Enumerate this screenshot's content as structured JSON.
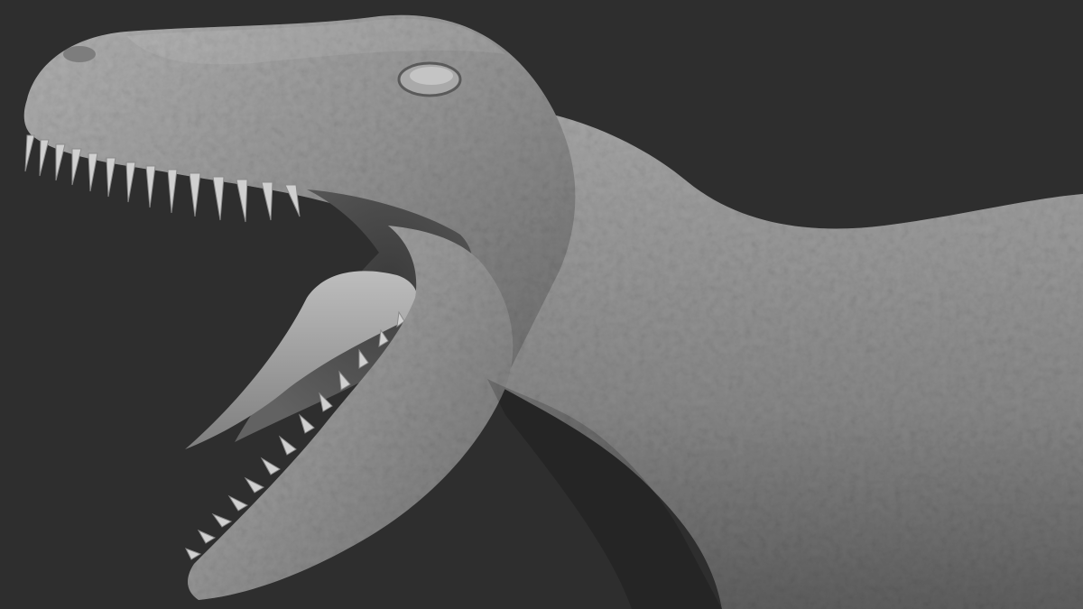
{
  "scene": {
    "subject": "dinosaur-head-sculpt",
    "background_color": "#2e2e2e",
    "material_base_color": "#8e8e8e",
    "material_light_color": "#b4b4b4",
    "material_dark_color": "#4a4a4a",
    "mouth_interior_color": "#5a5a5a",
    "tongue_color": "#9c9c9c",
    "teeth_color": "#cfcfcf"
  }
}
